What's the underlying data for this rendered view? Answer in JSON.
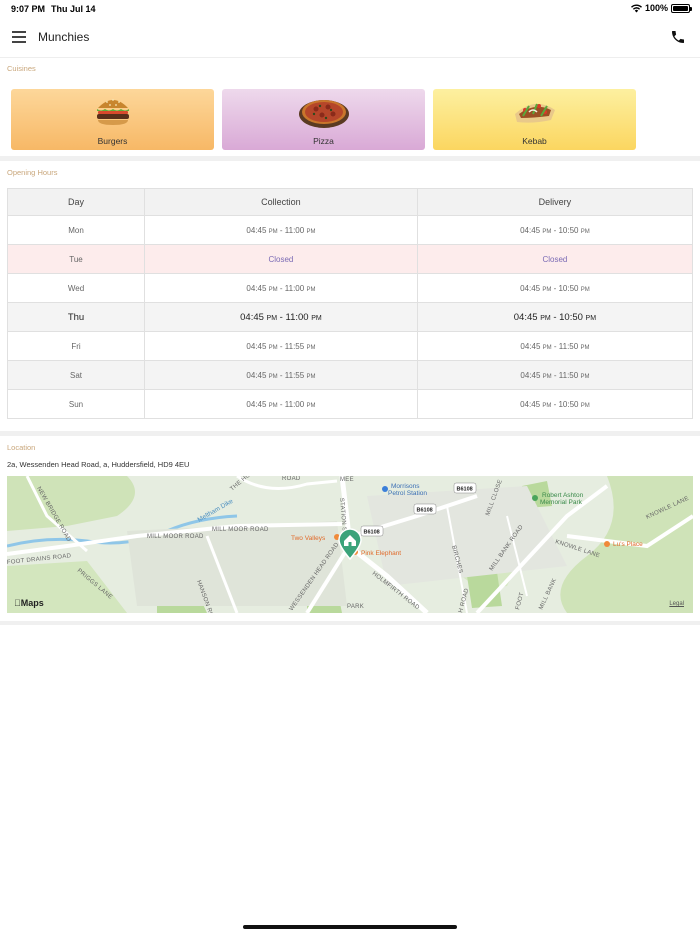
{
  "status_bar": {
    "time": "9:07 PM",
    "date": "Thu Jul 14",
    "battery": "100%"
  },
  "nav": {
    "title": "Munchies",
    "menu_icon": "hamburger-icon",
    "call_icon": "phone-icon"
  },
  "cuisines": {
    "label": "Cuisines",
    "items": [
      {
        "name": "Burgers",
        "icon": "burger-icon",
        "gradient": [
          "#fdd79a",
          "#f7b866"
        ]
      },
      {
        "name": "Pizza",
        "icon": "pizza-icon",
        "gradient": [
          "#eed9ec",
          "#d9a9d6"
        ]
      },
      {
        "name": "Kebab",
        "icon": "kebab-icon",
        "gradient": [
          "#fdf0a0",
          "#fbd660"
        ]
      }
    ]
  },
  "opening_hours": {
    "label": "Opening Hours",
    "headers": [
      "Day",
      "Collection",
      "Delivery"
    ],
    "rows": [
      {
        "day": "Mon",
        "collection": [
          "04:45",
          "PM",
          " - 11:00",
          "PM"
        ],
        "delivery": [
          "04:45",
          "PM",
          " - 10:50",
          "PM"
        ]
      },
      {
        "day": "Tue",
        "collection_text": "Closed",
        "delivery_text": "Closed"
      },
      {
        "day": "Wed",
        "collection": [
          "04:45",
          "PM",
          " - 11:00",
          "PM"
        ],
        "delivery": [
          "04:45",
          "PM",
          " - 10:50",
          "PM"
        ]
      },
      {
        "day": "Thu",
        "collection": [
          "04:45",
          "PM",
          " - 11:00",
          "PM"
        ],
        "delivery": [
          "04:45",
          "PM",
          " - 10:50",
          "PM"
        ]
      },
      {
        "day": "Fri",
        "collection": [
          "04:45",
          "PM",
          " - 11:55",
          "PM"
        ],
        "delivery": [
          "04:45",
          "PM",
          " - 11:50",
          "PM"
        ]
      },
      {
        "day": "Sat",
        "collection": [
          "04:45",
          "PM",
          " - 11:55",
          "PM"
        ],
        "delivery": [
          "04:45",
          "PM",
          " - 11:50",
          "PM"
        ]
      },
      {
        "day": "Sun",
        "collection": [
          "04:45",
          "PM",
          " - 11:00",
          "PM"
        ],
        "delivery": [
          "04:45",
          "PM",
          " - 10:50",
          "PM"
        ]
      }
    ]
  },
  "location": {
    "label": "Location",
    "address": "2a, Wessenden Head Road, a, Huddersfield, HD9 4EU",
    "map": {
      "roads": [
        "MILL MOOR ROAD",
        "WESSENDEN HEAD ROAD",
        "HOLMFIRTH ROAD",
        "STATION S",
        "MILL BANK ROAD",
        "KNOWLE LANE",
        "KNOWLE LANE",
        "NEW BRIDGE ROAD",
        "ROAD",
        "PRIGGS LANE",
        "FOOT DRAINS ROAD",
        "HANSON ROAD",
        "THE HOLLOW",
        "MILL MOOR ROAD",
        "BIRCHES",
        "MILL CLOSE",
        "H ROAD",
        "MILL BANK",
        "FOOT",
        "PARK",
        "MEE"
      ],
      "badges": [
        "B6108",
        "B6108",
        "B6108"
      ],
      "pois": [
        "Morrisons\nPetrol Station",
        "Robert Ashton\nMemorial Park",
        "Lu's Place",
        "Two Valleys",
        "Pink Elephant"
      ],
      "water_label": "Meltham Dike",
      "attribution": "Maps",
      "legal": "Legal"
    }
  }
}
